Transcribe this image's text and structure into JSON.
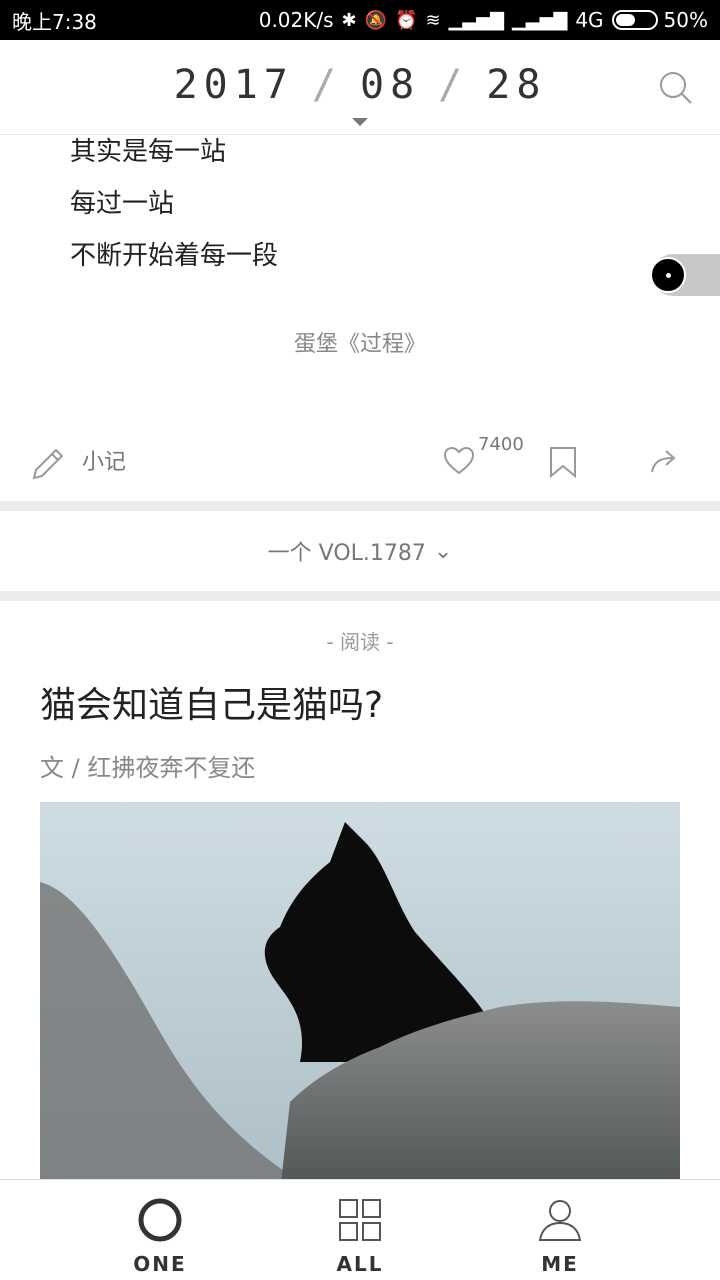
{
  "status_bar": {
    "time": "晚上7:38",
    "speed": "0.02K/s",
    "network": "4G",
    "battery": "50%",
    "battery_level": 0.5
  },
  "header": {
    "year": "2017",
    "month": "08",
    "day": "28",
    "separator": "/"
  },
  "poem": {
    "lines": [
      "其实是每一站",
      "每过一站",
      "不断开始着每一段"
    ],
    "source": "蛋堡《过程》"
  },
  "actions": {
    "note_label": "小记",
    "like_count": "7400"
  },
  "volume": {
    "label": "一个 VOL.1787"
  },
  "article": {
    "section": "- 阅读 -",
    "title": "猫会知道自己是猫吗?",
    "author": "文 / 红拂夜奔不复还"
  },
  "tabs": [
    {
      "label": "ONE",
      "icon": "circle-icon"
    },
    {
      "label": "ALL",
      "icon": "grid-icon"
    },
    {
      "label": "ME",
      "icon": "person-icon"
    }
  ],
  "colors": {
    "accent": "#333333",
    "divider": "#ececec"
  }
}
